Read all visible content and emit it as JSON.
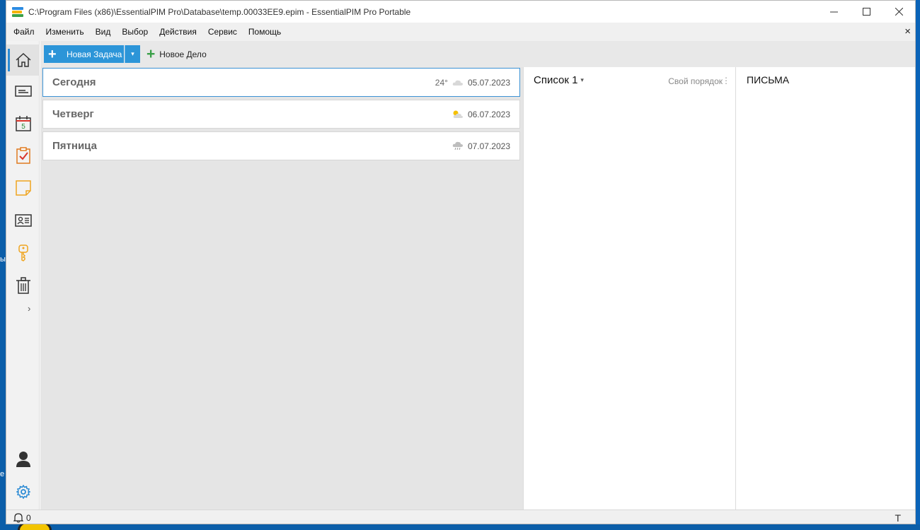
{
  "window": {
    "title": "C:\\Program Files (x86)\\EssentialPIM Pro\\Database\\temp.00033EE9.epim - EssentialPIM Pro Portable",
    "controls": {
      "minimize": "—",
      "maximize": "☐",
      "close": "✕"
    }
  },
  "menu": {
    "items": [
      "Файл",
      "Изменить",
      "Вид",
      "Выбор",
      "Действия",
      "Сервис",
      "Помощь"
    ],
    "close": "×"
  },
  "toolbar": {
    "new_task_label": "Новая Задача",
    "new_item_label": "Новое Дело",
    "plus": "+",
    "dropdown": "▾"
  },
  "nav": {
    "items": [
      "home-icon",
      "mail-icon",
      "calendar-icon",
      "tasks-icon",
      "notes-icon",
      "contacts-icon",
      "passwords-icon",
      "trash-icon"
    ],
    "calendar_day": "5",
    "expand": "›",
    "bottom": [
      "user-icon",
      "settings-icon"
    ]
  },
  "days": [
    {
      "name": "Сегодня",
      "temp": "24°",
      "weather": "cloud-icon",
      "date": "05.07.2023",
      "selected": true
    },
    {
      "name": "Четверг",
      "temp": "",
      "weather": "partly-sunny-icon",
      "date": "06.07.2023",
      "selected": false
    },
    {
      "name": "Пятница",
      "temp": "",
      "weather": "rain-icon",
      "date": "07.07.2023",
      "selected": false
    }
  ],
  "list": {
    "title": "Список 1",
    "caret": "▾",
    "order": "Свой порядок",
    "dots": "⋮"
  },
  "mail": {
    "title": "ПИСЬМА"
  },
  "status": {
    "notifications": "0",
    "right_icon": "T"
  },
  "desktop": {
    "fragments": [
      "ы",
      "e"
    ]
  }
}
